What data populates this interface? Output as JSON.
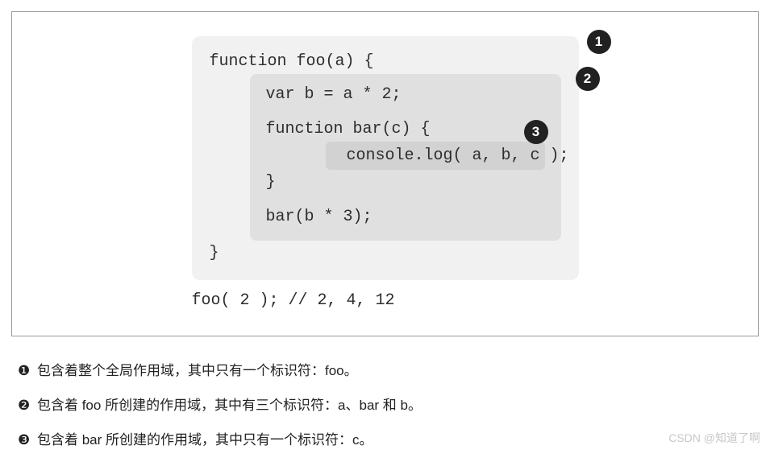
{
  "code": {
    "l1": "function foo(a) {",
    "l2": "var b = a * 2;",
    "l3": "function bar(c) {",
    "l4": "console.log( a, b, c );",
    "l5": "}",
    "l6": "bar(b * 3);",
    "l7": "}",
    "l8": "foo( 2 ); // 2, 4, 12"
  },
  "bubbles": {
    "n1": "1",
    "n2": "2",
    "n3": "3"
  },
  "markers": {
    "m1": "❶",
    "m2": "❷",
    "m3": "❸"
  },
  "explanations": {
    "e1": "包含着整个全局作用域，其中只有一个标识符：foo。",
    "e2": "包含着 foo 所创建的作用域，其中有三个标识符：a、bar 和 b。",
    "e3": "包含着 bar 所创建的作用域，其中只有一个标识符：c。"
  },
  "watermark": "CSDN @知道了啊"
}
